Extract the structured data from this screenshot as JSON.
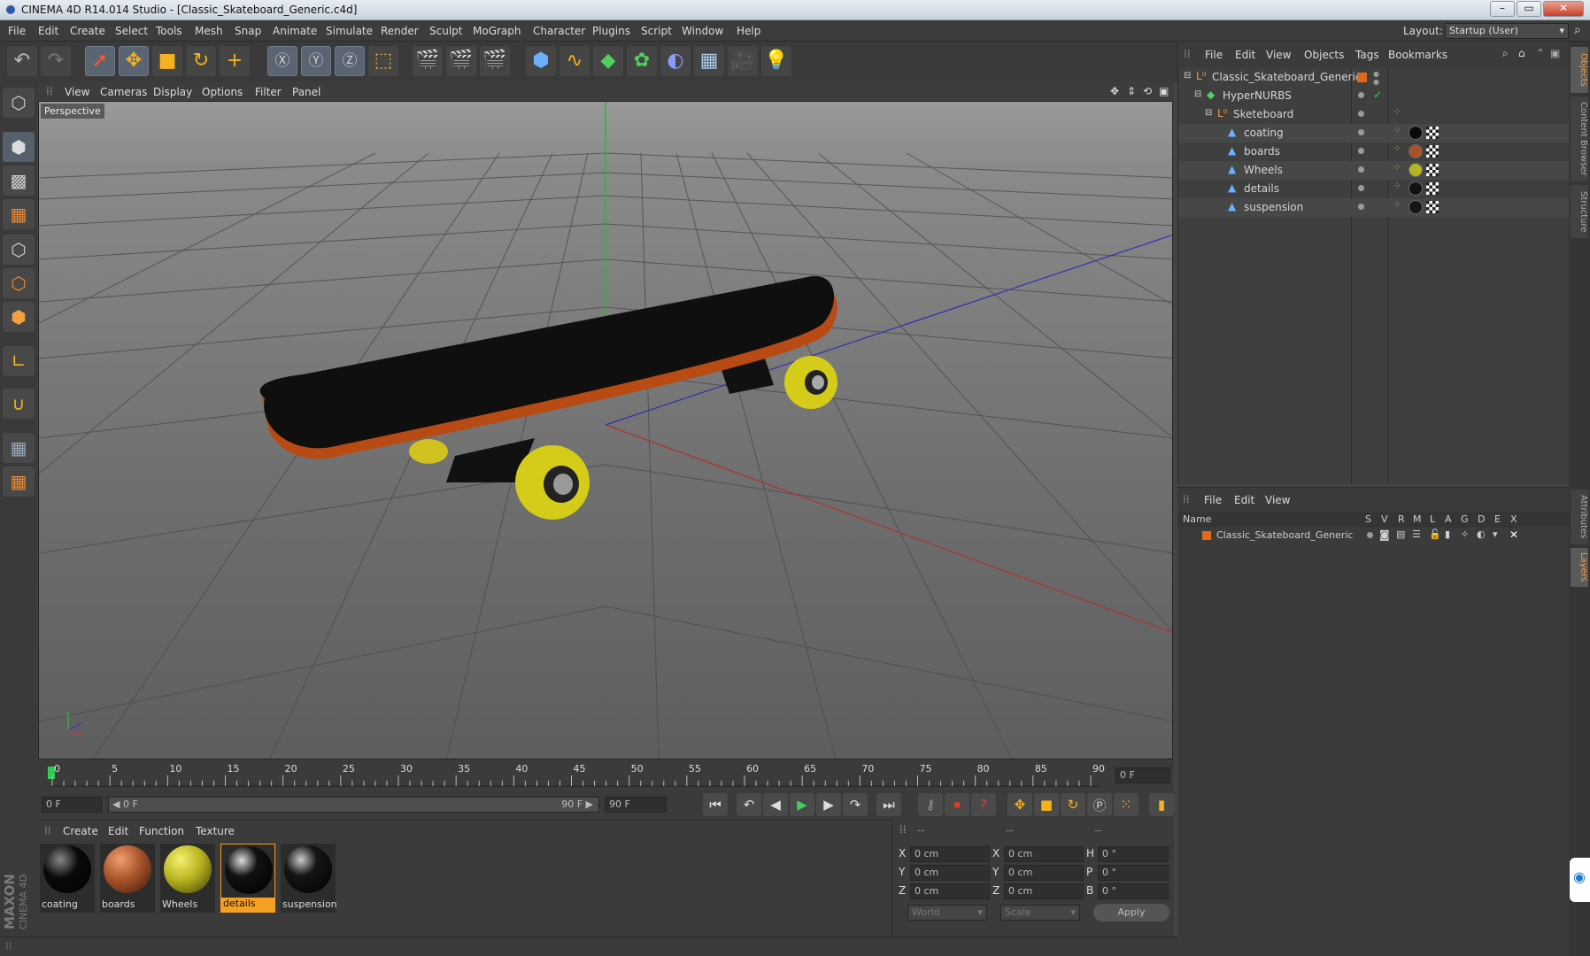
{
  "window": {
    "title": "CINEMA 4D R14.014 Studio - [Classic_Skateboard_Generic.c4d]",
    "minimize": "–",
    "maximize": "▭",
    "close": "✕"
  },
  "menu": [
    "File",
    "Edit",
    "Create",
    "Select",
    "Tools",
    "Mesh",
    "Snap",
    "Animate",
    "Simulate",
    "Render",
    "Sculpt",
    "MoGraph",
    "Character",
    "Plugins",
    "Script",
    "Window",
    "Help"
  ],
  "layout": {
    "label": "Layout:",
    "value": "Startup (User)"
  },
  "viewport": {
    "menu": [
      "View",
      "Cameras",
      "Display",
      "Options",
      "Filter",
      "Panel"
    ],
    "label": "Perspective"
  },
  "timeline": {
    "ticks": [
      "0",
      "5",
      "10",
      "15",
      "20",
      "25",
      "30",
      "35",
      "40",
      "45",
      "50",
      "55",
      "60",
      "65",
      "70",
      "75",
      "80",
      "85",
      "90"
    ],
    "frame_display": "0 F"
  },
  "transport": {
    "start": "0 F",
    "range_start": "◀ 0 F",
    "range_end": "90 F ▶",
    "end": "90 F"
  },
  "materials": {
    "menu": [
      "Create",
      "Edit",
      "Function",
      "Texture"
    ],
    "items": [
      {
        "name": "coating",
        "color": "#0a0a0a"
      },
      {
        "name": "boards",
        "color": "#a8532a"
      },
      {
        "name": "Wheels",
        "color": "#b8b420"
      },
      {
        "name": "details",
        "color": "#111111",
        "selected": true
      },
      {
        "name": "suspension",
        "color": "#151515"
      }
    ]
  },
  "coords": {
    "header": [
      "--",
      "--",
      "--"
    ],
    "rows": [
      {
        "a": "X",
        "av": "0 cm",
        "b": "X",
        "bv": "0 cm",
        "c": "H",
        "cv": "0 °"
      },
      {
        "a": "Y",
        "av": "0 cm",
        "b": "Y",
        "bv": "0 cm",
        "c": "P",
        "cv": "0 °"
      },
      {
        "a": "Z",
        "av": "0 cm",
        "b": "Z",
        "bv": "0 cm",
        "c": "B",
        "cv": "0 °"
      }
    ],
    "world": "World",
    "scale": "Scale",
    "apply": "Apply"
  },
  "maxon": {
    "line1": "MAXON",
    "line2": "CINEMA 4D"
  },
  "objects": {
    "menu": [
      "File",
      "Edit",
      "View",
      "Objects",
      "Tags",
      "Bookmarks"
    ],
    "tree": [
      {
        "name": "Classic_Skateboard_Generic",
        "indent": 0,
        "tags": []
      },
      {
        "name": "HyperNURBS",
        "indent": 1,
        "tags": []
      },
      {
        "name": "Sketeboard",
        "indent": 2,
        "tags": []
      },
      {
        "name": "coating",
        "indent": 3,
        "tags": [
          "#0a0a0a"
        ]
      },
      {
        "name": "boards",
        "indent": 3,
        "tags": [
          "#a8532a"
        ]
      },
      {
        "name": "Wheels",
        "indent": 3,
        "tags": [
          "#b8b420"
        ]
      },
      {
        "name": "details",
        "indent": 3,
        "tags": [
          "#111111"
        ]
      },
      {
        "name": "suspension",
        "indent": 3,
        "tags": [
          "#151515"
        ]
      }
    ]
  },
  "layers": {
    "menu": [
      "File",
      "Edit",
      "View"
    ],
    "columns": [
      "Name",
      "S",
      "V",
      "R",
      "M",
      "L",
      "A",
      "G",
      "D",
      "E",
      "X"
    ],
    "rows": [
      {
        "name": "Classic_Skateboard_Generic",
        "color": "#e06a1a"
      }
    ]
  },
  "sidetabs": [
    "Objects",
    "Content Browser",
    "Structure",
    "Attributes",
    "Layers"
  ]
}
